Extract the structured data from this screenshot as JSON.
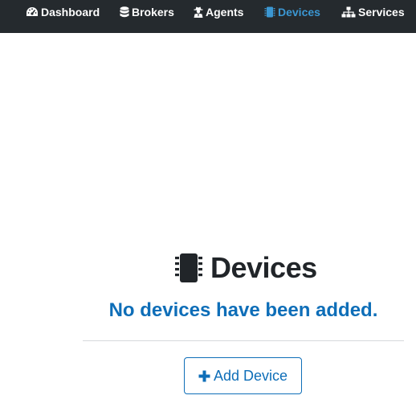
{
  "nav": {
    "items": [
      {
        "label": "Dashboard",
        "icon": "tachometer-icon",
        "active": false
      },
      {
        "label": "Brokers",
        "icon": "database-icon",
        "active": false
      },
      {
        "label": "Agents",
        "icon": "user-secret-icon",
        "active": false
      },
      {
        "label": "Devices",
        "icon": "microchip-icon",
        "active": true
      },
      {
        "label": "Services",
        "icon": "sitemap-icon",
        "active": false
      }
    ]
  },
  "main": {
    "title": "Devices",
    "title_icon": "microchip-icon",
    "empty_message": "No devices have been added.",
    "add_button_label": "Add Device",
    "add_button_icon": "plus-icon"
  },
  "colors": {
    "navbar_bg": "#252a2e",
    "nav_text": "#ffffff",
    "nav_active": "#3b97d3",
    "accent": "#0e6eb8",
    "title_text": "#212529"
  }
}
